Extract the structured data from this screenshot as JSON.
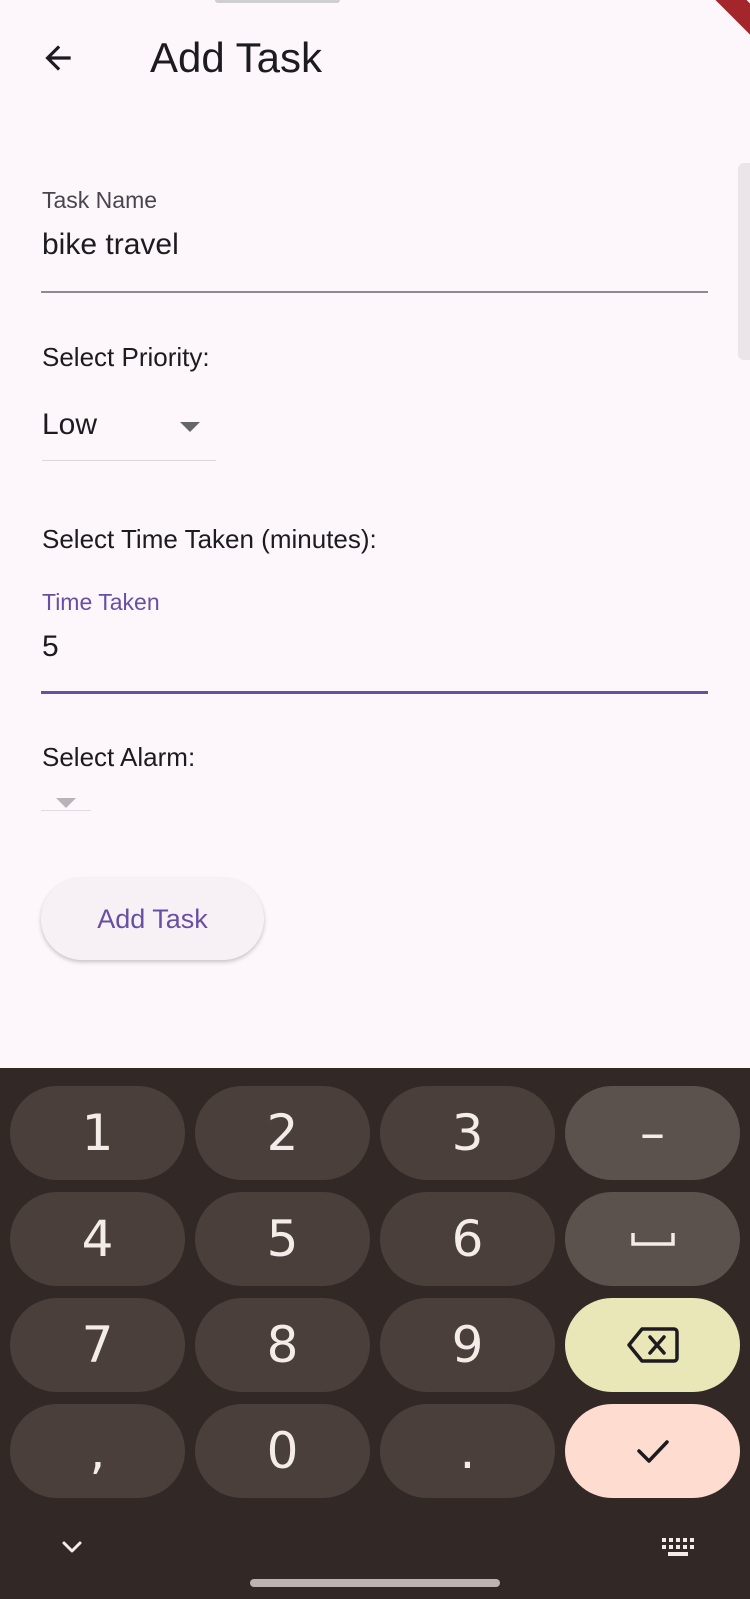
{
  "appbar": {
    "title": "Add Task",
    "back_icon": "arrow-left-icon"
  },
  "form": {
    "task_name": {
      "label": "Task Name",
      "value": "bike travel"
    },
    "priority": {
      "label": "Select Priority:",
      "selected": "Low"
    },
    "time_taken": {
      "section_label": "Select Time Taken (minutes):",
      "label": "Time Taken",
      "value": "5"
    },
    "alarm": {
      "label": "Select Alarm:",
      "selected": ""
    },
    "submit_label": "Add Task"
  },
  "colors": {
    "accent": "#6750a4",
    "background": "#fdf7fb",
    "keyboard_bg": "#322825"
  },
  "keyboard": {
    "rows": [
      [
        "1",
        "2",
        "3",
        "–"
      ],
      [
        "4",
        "5",
        "6",
        "space"
      ],
      [
        "7",
        "8",
        "9",
        "backspace"
      ],
      [
        ",",
        "0",
        ".",
        "enter"
      ]
    ],
    "hide_icon": "chevron-down-icon",
    "switch_icon": "keyboard-icon"
  }
}
